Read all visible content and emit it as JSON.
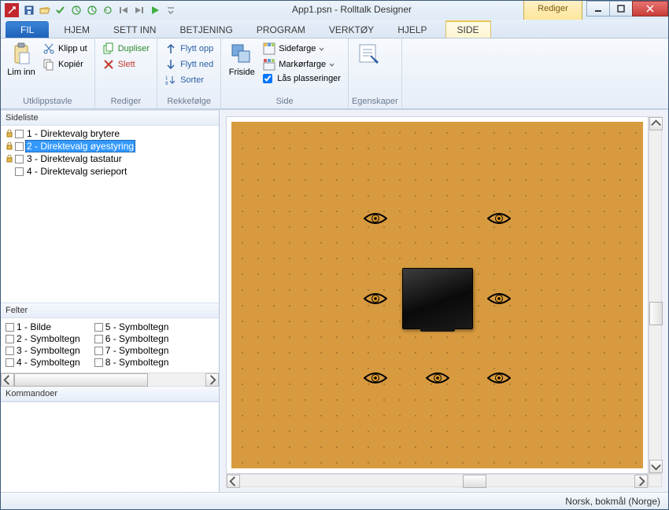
{
  "title": "App1.psn - Rolltalk Designer",
  "contextual_tab_header": "Rediger",
  "tabs": {
    "file": "FIL",
    "hjem": "HJEM",
    "settinn": "SETT INN",
    "betjening": "BETJENING",
    "program": "PROGRAM",
    "verktoy": "VERKTØY",
    "hjelp": "HJELP",
    "side": "SIDE"
  },
  "ribbon": {
    "utklipp": {
      "liminn": "Lim inn",
      "klippu": "Klipp ut",
      "kopier": "Kopiér",
      "label": "Utklippstavle"
    },
    "rediger": {
      "dupliser": "Dupliser",
      "slett": "Slett",
      "label": "Rediger"
    },
    "rekke": {
      "flyttopp": "Flytt opp",
      "flyttned": "Flytt ned",
      "sorter": "Sorter",
      "label": "Rekkefølge"
    },
    "side": {
      "friside": "Friside",
      "sidefarge": "Sidefarge",
      "markorfarge": "Markørfarge",
      "las": "Lås plasseringer",
      "label": "Side"
    },
    "egen": {
      "btn": "",
      "label": "Egenskaper"
    }
  },
  "sideliste": {
    "header": "Sideliste",
    "items": [
      {
        "label": "1 - Direktevalg brytere",
        "locked": true
      },
      {
        "label": "2 - Direktevalg øyestyring",
        "locked": true,
        "selected": true
      },
      {
        "label": "3 - Direktevalg tastatur",
        "locked": true
      },
      {
        "label": "4 - Direktevalg serieport",
        "locked": false
      }
    ]
  },
  "felter": {
    "header": "Felter",
    "col1": [
      "1 - Bilde",
      "2 - Symboltegn",
      "3 - Symboltegn",
      "4 - Symboltegn"
    ],
    "col2": [
      "5 - Symboltegn",
      "6 - Symboltegn",
      "7 - Symboltegn",
      "8 - Symboltegn"
    ]
  },
  "kommandoer": {
    "header": "Kommandoer"
  },
  "status": "Norsk, bokmål (Norge)"
}
